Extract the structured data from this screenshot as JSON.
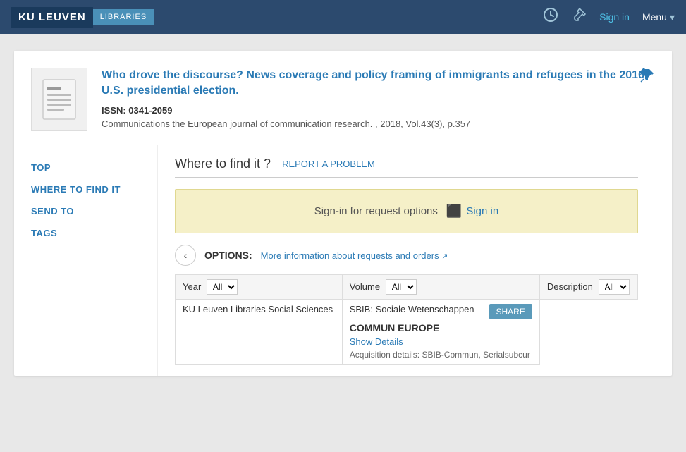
{
  "header": {
    "logo": "KU LEUVEN",
    "libraries": "LIBRARIES",
    "sign_in": "Sign in",
    "menu": "Menu",
    "history_icon": "⟳",
    "pin_icon": "📌"
  },
  "article": {
    "title": "Who drove the discourse? News coverage and policy framing of immigrants and refugees in the 2016 U.S. presidential election.",
    "issn_label": "ISSN:",
    "issn": "0341-2059",
    "journal": "Communications the European journal of communication research. , 2018, Vol.43(3), p.357"
  },
  "sidebar": {
    "items": [
      {
        "label": "TOP",
        "id": "top"
      },
      {
        "label": "WHERE TO FIND IT",
        "id": "where-to-find-it"
      },
      {
        "label": "SEND TO",
        "id": "send-to"
      },
      {
        "label": "TAGS",
        "id": "tags"
      }
    ]
  },
  "where_to_find": {
    "title": "Where to find it ?",
    "report_problem": "REPORT A PROBLEM",
    "signin_box": {
      "text": "Sign-in for request options",
      "sign_in_label": "Sign in"
    },
    "options": {
      "label": "OPTIONS:",
      "more_info": "More information about requests and orders"
    },
    "table": {
      "columns": [
        {
          "label": "Year",
          "filter": "All"
        },
        {
          "label": "Volume",
          "filter": "All"
        },
        {
          "label": "Description",
          "filter": "All"
        }
      ],
      "rows": [
        {
          "location": "KU Leuven Libraries Social Sciences",
          "sbib": "SBIB: Sociale Wetenschappen",
          "name": "COMMUN EUROPE",
          "show_details": "Show Details",
          "acquisition": "Acquisition details: SBIB-Commun, Serialsubcur"
        }
      ]
    }
  }
}
